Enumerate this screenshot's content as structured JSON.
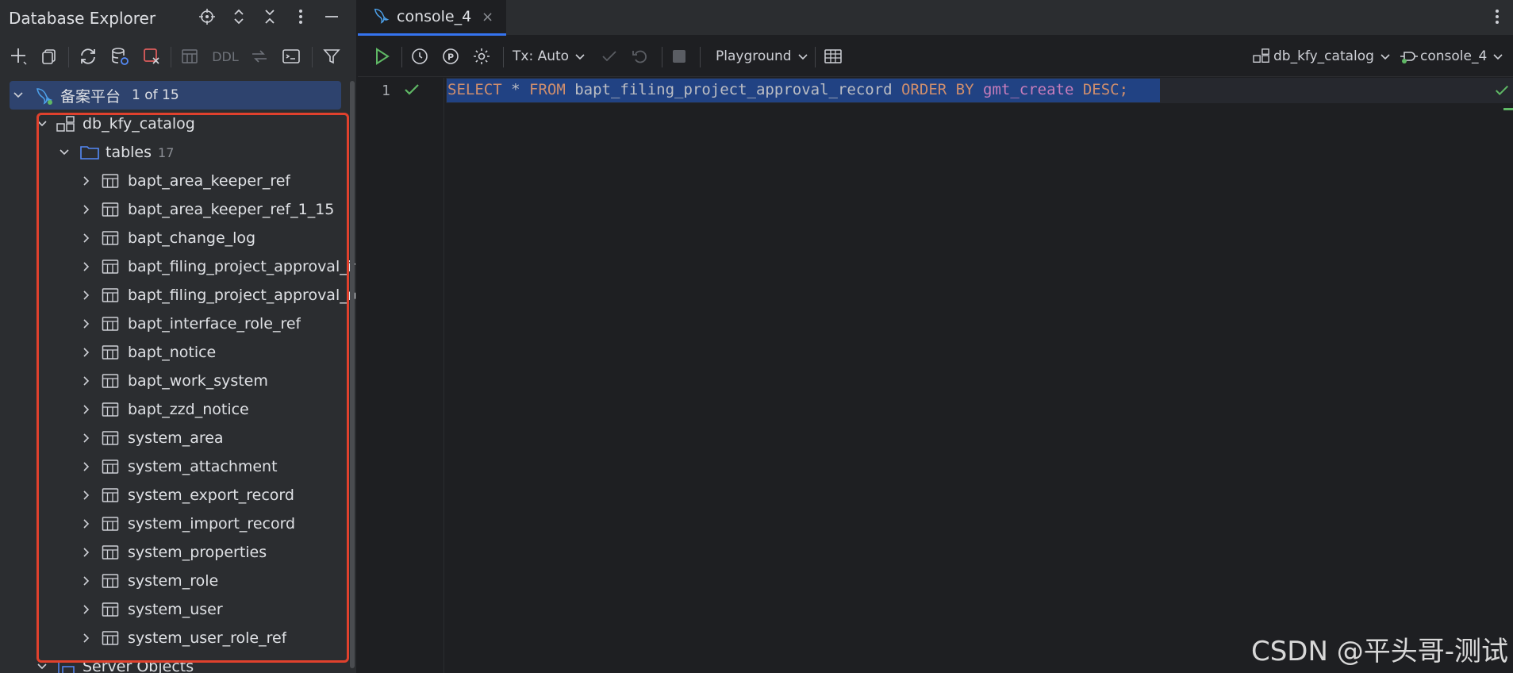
{
  "left_panel": {
    "title": "Database Explorer",
    "toolbar": {
      "ddl_label": "DDL"
    },
    "tree": {
      "root": {
        "label": "备案平台",
        "badge": "1 of 15"
      },
      "catalog": {
        "label": "db_kfy_catalog"
      },
      "tables_folder": {
        "label": "tables",
        "count": "17"
      },
      "tables": [
        "bapt_area_keeper_ref",
        "bapt_area_keeper_ref_1_15",
        "bapt_change_log",
        "bapt_filing_project_approval_int",
        "bapt_filing_project_approval_re",
        "bapt_interface_role_ref",
        "bapt_notice",
        "bapt_work_system",
        "bapt_zzd_notice",
        "system_area",
        "system_attachment",
        "system_export_record",
        "system_import_record",
        "system_properties",
        "system_role",
        "system_user",
        "system_user_role_ref"
      ],
      "server_objects": {
        "label": "Server Objects"
      }
    },
    "highlight_color": "#e0412d"
  },
  "editor": {
    "tab": {
      "label": "console_4",
      "close": "×"
    },
    "toolbar": {
      "tx_mode": "Tx: Auto",
      "playground": "Playground",
      "schema": "db_kfy_catalog",
      "session": "console_4"
    },
    "line_number": "1",
    "sql": {
      "select": "SELECT",
      "star": "*",
      "from": "FROM",
      "table": "bapt_filing_project_approval_record",
      "order_by": "ORDER BY",
      "column": "gmt_create",
      "desc": "DESC",
      "semicolon": ";"
    }
  },
  "watermark": "CSDN @平头哥-测试",
  "colors": {
    "accent": "#3574f0",
    "selection": "#214283",
    "keyword": "#cf8e6d",
    "field": "#c77dbb",
    "success": "#5fb865"
  }
}
